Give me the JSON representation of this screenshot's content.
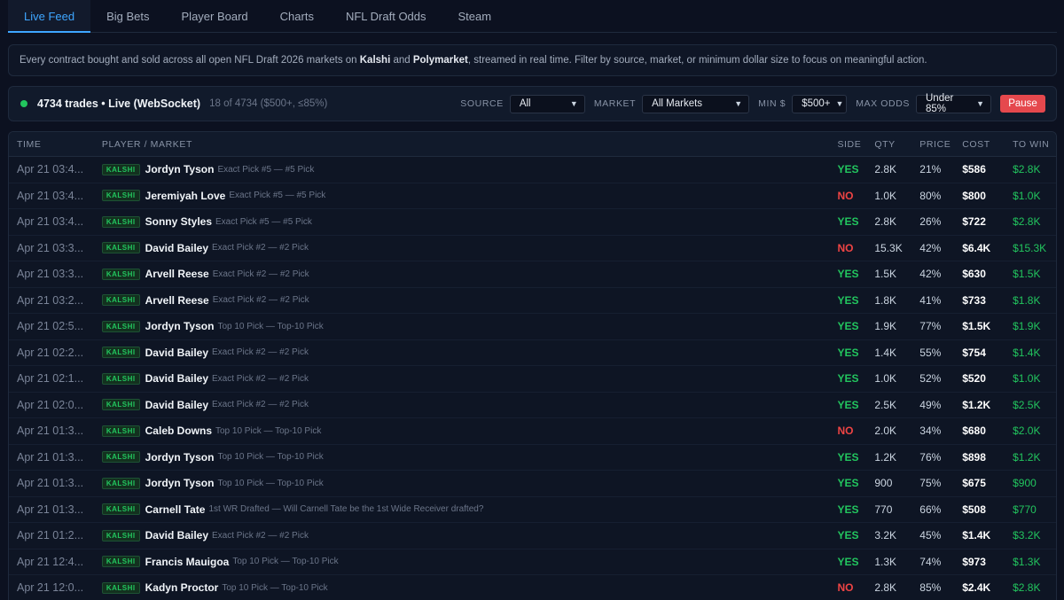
{
  "tabs": [
    {
      "label": "Live Feed",
      "active": true
    },
    {
      "label": "Big Bets",
      "active": false
    },
    {
      "label": "Player Board",
      "active": false
    },
    {
      "label": "Charts",
      "active": false
    },
    {
      "label": "NFL Draft Odds",
      "active": false
    },
    {
      "label": "Steam",
      "active": false
    }
  ],
  "description": {
    "part1": "Every contract bought and sold across all open NFL Draft 2026 markets on ",
    "kalshi": "Kalshi",
    "part2": " and ",
    "polymarket": "Polymarket",
    "part3": ", streamed in real time. Filter by source, market, or minimum dollar size to focus on meaningful action."
  },
  "status": {
    "title": "4734 trades • Live (WebSocket)",
    "subtitle": "18 of 4734 ($500+, ≤85%)",
    "dot_color": "#22c55e"
  },
  "filters": {
    "source_label": "SOURCE",
    "source_value": "All",
    "market_label": "MARKET",
    "market_value": "All Markets",
    "min_label": "MIN $",
    "min_value": "$500+",
    "odds_label": "MAX ODDS",
    "odds_value": "Under 85%",
    "pause_label": "Pause"
  },
  "columns": {
    "time": "TIME",
    "player": "PLAYER / MARKET",
    "side": "SIDE",
    "qty": "QTY",
    "price": "PRICE",
    "cost": "COST",
    "win": "TO WIN"
  },
  "rows": [
    {
      "time": "Apr 21 03:4...",
      "source": "KALSHI",
      "player": "Jordyn Tyson",
      "market": "Exact Pick #5 — #5 Pick",
      "side": "YES",
      "qty": "2.8K",
      "price": "21%",
      "cost": "$586",
      "win": "$2.8K"
    },
    {
      "time": "Apr 21 03:4...",
      "source": "KALSHI",
      "player": "Jeremiyah Love",
      "market": "Exact Pick #5 — #5 Pick",
      "side": "NO",
      "qty": "1.0K",
      "price": "80%",
      "cost": "$800",
      "win": "$1.0K"
    },
    {
      "time": "Apr 21 03:4...",
      "source": "KALSHI",
      "player": "Sonny Styles",
      "market": "Exact Pick #5 — #5 Pick",
      "side": "YES",
      "qty": "2.8K",
      "price": "26%",
      "cost": "$722",
      "win": "$2.8K"
    },
    {
      "time": "Apr 21 03:3...",
      "source": "KALSHI",
      "player": "David Bailey",
      "market": "Exact Pick #2 — #2 Pick",
      "side": "NO",
      "qty": "15.3K",
      "price": "42%",
      "cost": "$6.4K",
      "win": "$15.3K"
    },
    {
      "time": "Apr 21 03:3...",
      "source": "KALSHI",
      "player": "Arvell Reese",
      "market": "Exact Pick #2 — #2 Pick",
      "side": "YES",
      "qty": "1.5K",
      "price": "42%",
      "cost": "$630",
      "win": "$1.5K"
    },
    {
      "time": "Apr 21 03:2...",
      "source": "KALSHI",
      "player": "Arvell Reese",
      "market": "Exact Pick #2 — #2 Pick",
      "side": "YES",
      "qty": "1.8K",
      "price": "41%",
      "cost": "$733",
      "win": "$1.8K"
    },
    {
      "time": "Apr 21 02:5...",
      "source": "KALSHI",
      "player": "Jordyn Tyson",
      "market": "Top 10 Pick — Top-10 Pick",
      "side": "YES",
      "qty": "1.9K",
      "price": "77%",
      "cost": "$1.5K",
      "win": "$1.9K"
    },
    {
      "time": "Apr 21 02:2...",
      "source": "KALSHI",
      "player": "David Bailey",
      "market": "Exact Pick #2 — #2 Pick",
      "side": "YES",
      "qty": "1.4K",
      "price": "55%",
      "cost": "$754",
      "win": "$1.4K"
    },
    {
      "time": "Apr 21 02:1...",
      "source": "KALSHI",
      "player": "David Bailey",
      "market": "Exact Pick #2 — #2 Pick",
      "side": "YES",
      "qty": "1.0K",
      "price": "52%",
      "cost": "$520",
      "win": "$1.0K"
    },
    {
      "time": "Apr 21 02:0...",
      "source": "KALSHI",
      "player": "David Bailey",
      "market": "Exact Pick #2 — #2 Pick",
      "side": "YES",
      "qty": "2.5K",
      "price": "49%",
      "cost": "$1.2K",
      "win": "$2.5K"
    },
    {
      "time": "Apr 21 01:3...",
      "source": "KALSHI",
      "player": "Caleb Downs",
      "market": "Top 10 Pick — Top-10 Pick",
      "side": "NO",
      "qty": "2.0K",
      "price": "34%",
      "cost": "$680",
      "win": "$2.0K"
    },
    {
      "time": "Apr 21 01:3...",
      "source": "KALSHI",
      "player": "Jordyn Tyson",
      "market": "Top 10 Pick — Top-10 Pick",
      "side": "YES",
      "qty": "1.2K",
      "price": "76%",
      "cost": "$898",
      "win": "$1.2K"
    },
    {
      "time": "Apr 21 01:3...",
      "source": "KALSHI",
      "player": "Jordyn Tyson",
      "market": "Top 10 Pick — Top-10 Pick",
      "side": "YES",
      "qty": "900",
      "price": "75%",
      "cost": "$675",
      "win": "$900"
    },
    {
      "time": "Apr 21 01:3...",
      "source": "KALSHI",
      "player": "Carnell Tate",
      "market": "1st WR Drafted — Will Carnell Tate be the 1st Wide Receiver drafted?",
      "side": "YES",
      "qty": "770",
      "price": "66%",
      "cost": "$508",
      "win": "$770"
    },
    {
      "time": "Apr 21 01:2...",
      "source": "KALSHI",
      "player": "David Bailey",
      "market": "Exact Pick #2 — #2 Pick",
      "side": "YES",
      "qty": "3.2K",
      "price": "45%",
      "cost": "$1.4K",
      "win": "$3.2K"
    },
    {
      "time": "Apr 21 12:4...",
      "source": "KALSHI",
      "player": "Francis Mauigoa",
      "market": "Top 10 Pick — Top-10 Pick",
      "side": "YES",
      "qty": "1.3K",
      "price": "74%",
      "cost": "$973",
      "win": "$1.3K"
    },
    {
      "time": "Apr 21 12:0...",
      "source": "KALSHI",
      "player": "Kadyn Proctor",
      "market": "Top 10 Pick — Top-10 Pick",
      "side": "NO",
      "qty": "2.8K",
      "price": "85%",
      "cost": "$2.4K",
      "win": "$2.8K"
    }
  ]
}
